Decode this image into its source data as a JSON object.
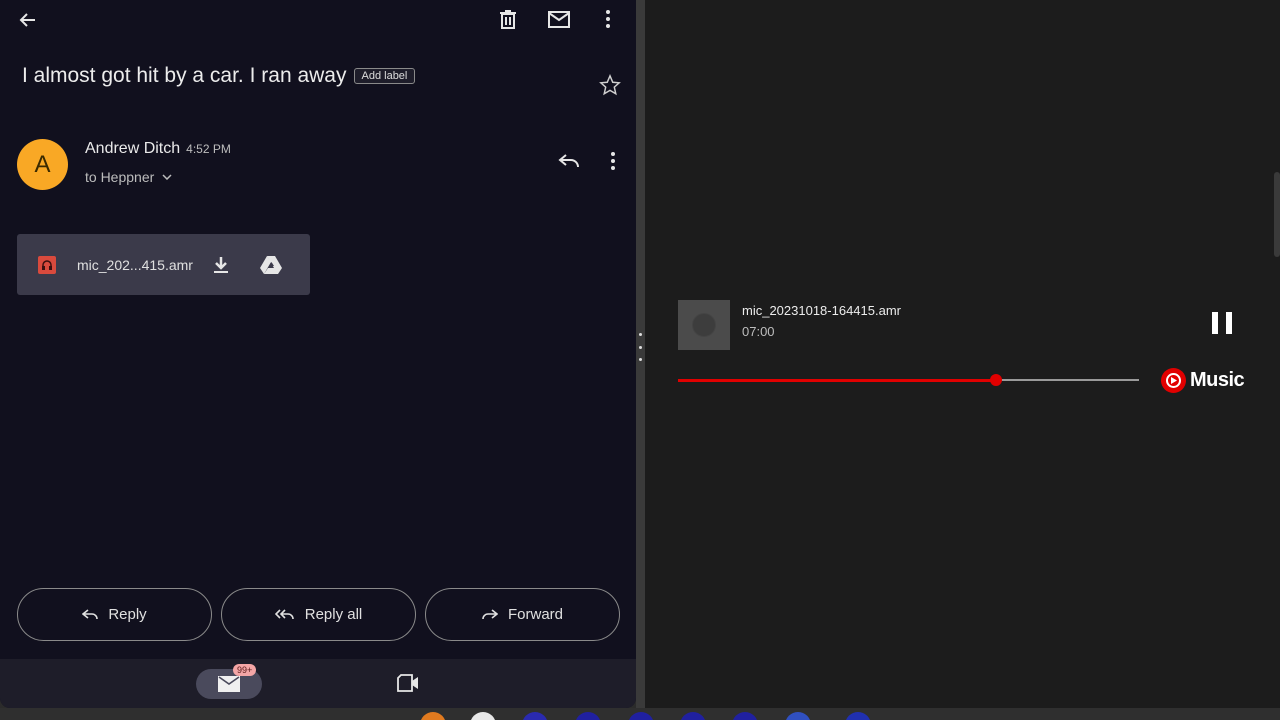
{
  "email": {
    "subject": "I almost got hit by a car. I ran away",
    "add_label": "Add label",
    "sender_initial": "A",
    "sender_name": "Andrew Ditch",
    "time": "4:52 PM",
    "recipient": "to Heppner",
    "attachment": {
      "name": "mic_202...415.amr"
    },
    "actions": {
      "reply": "Reply",
      "reply_all": "Reply all",
      "forward": "Forward"
    },
    "nav": {
      "mail_badge": "99+"
    },
    "colors": {
      "avatar": "#f9a825",
      "background": "#11101e"
    }
  },
  "player": {
    "title": "mic_20231018-164415.amr",
    "time": "07:00",
    "progress": 0.69,
    "brand": "Music",
    "colors": {
      "accent": "#e10000",
      "background": "#1c1c1c"
    }
  },
  "taskbar": {
    "icons": [
      {
        "name": "app-orange",
        "color": "#e07a1f"
      },
      {
        "name": "app-chrome",
        "color": "#e8e8e8"
      },
      {
        "name": "app-blue-1",
        "color": "#2a2ab0"
      },
      {
        "name": "app-blue-2",
        "color": "#2020a0"
      },
      {
        "name": "app-blue-3",
        "color": "#2020a0"
      },
      {
        "name": "app-blue-4",
        "color": "#2020a0"
      },
      {
        "name": "app-blue-5",
        "color": "#2020a0"
      },
      {
        "name": "app-badge-1",
        "color": "#3050c0"
      },
      {
        "name": "app-badge-2",
        "color": "#2030b0"
      }
    ]
  }
}
